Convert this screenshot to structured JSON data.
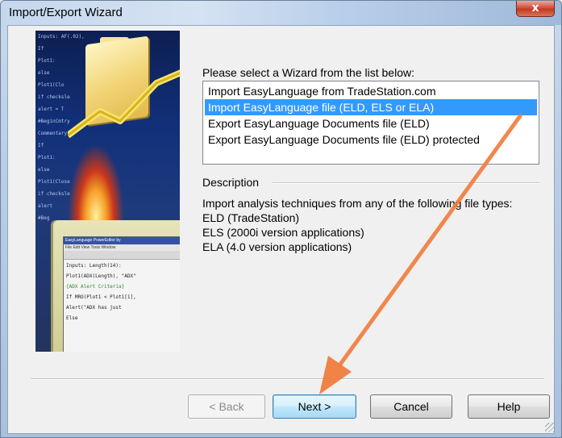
{
  "window": {
    "title": "Import/Export Wizard",
    "close_glyph": "x"
  },
  "wizard": {
    "prompt": "Please select a Wizard from the list below:",
    "items": [
      {
        "label": "Import EasyLanguage from TradeStation.com",
        "selected": false
      },
      {
        "label": "Import EasyLanguage file (ELD, ELS or ELA)",
        "selected": true
      },
      {
        "label": "Export EasyLanguage Documents file (ELD)",
        "selected": false
      },
      {
        "label": "Export EasyLanguage Documents file (ELD) protected",
        "selected": false
      }
    ]
  },
  "description": {
    "label": "Description",
    "lines": [
      "Import analysis techniques from any of the following file types:",
      "ELD (TradeStation)",
      "ELS (2000i version applications)",
      "ELA (4.0 version applications)"
    ]
  },
  "buttons": {
    "back": "< Back",
    "next": "Next >",
    "cancel": "Cancel",
    "help": "Help"
  },
  "illustration": {
    "code_lines": [
      "Inputs: AF(.02),",
      "If",
      "Plot1:",
      "else",
      "Plot1(Clo",
      "if checksle",
      "alert = T",
      "#BeginCmtry",
      "Commentary(",
      "If",
      "Plot1:",
      "else",
      "Plot1(Close",
      "if checksle",
      "alert",
      "#Beg"
    ],
    "screen_title": "EasyLanguage PowerEditor by",
    "screen_menu": "File  Edit  View  Tools  Window",
    "screen_code": [
      "Inputs: Length(14):",
      "Plot1(ADX(Length), \"ADX\"",
      "{ADX Alert Criteria}",
      "If MRO(Plot1 < Plot1[1],",
      "   Alert(\"ADX has just",
      "Else"
    ]
  },
  "colors": {
    "selection": "#3399ff",
    "annotation_arrow": "#f07c3c"
  }
}
